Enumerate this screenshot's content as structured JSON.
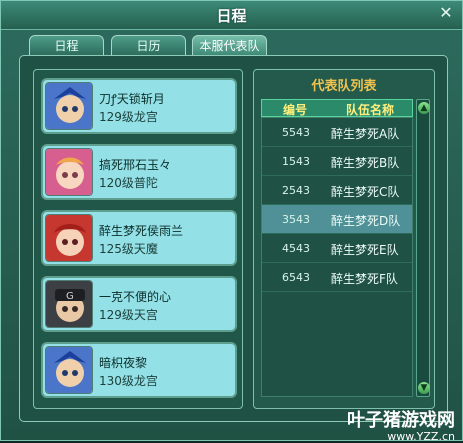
{
  "window": {
    "title": "日程"
  },
  "tabs": [
    {
      "label": "日程"
    },
    {
      "label": "日历"
    },
    {
      "label": "本服代表队"
    }
  ],
  "members": [
    {
      "name": "刀ꝭ天锁斩月",
      "desc": "129级龙宫"
    },
    {
      "name": "搞死邢石玉々",
      "desc": "120级普陀"
    },
    {
      "name": "醉生梦死侯雨兰",
      "desc": "125级天魔"
    },
    {
      "name": "一克不便的心",
      "desc": "129级天宫"
    },
    {
      "name": "暗枳夜黎",
      "desc": "130级龙宫"
    }
  ],
  "teamlist": {
    "title": "代表队列表",
    "headers": {
      "code": "编号",
      "team": "队伍名称"
    },
    "rows": [
      {
        "code": "5543",
        "team": "醉生梦死A队"
      },
      {
        "code": "1543",
        "team": "醉生梦死B队"
      },
      {
        "code": "2543",
        "team": "醉生梦死C队"
      },
      {
        "code": "3543",
        "team": "醉生梦死D队",
        "selected": true
      },
      {
        "code": "4543",
        "team": "醉生梦死E队"
      },
      {
        "code": "6543",
        "team": "醉生梦死F队"
      }
    ]
  },
  "watermark": {
    "text": "叶子猪游戏网",
    "sub": "www.YZZ.cn"
  }
}
